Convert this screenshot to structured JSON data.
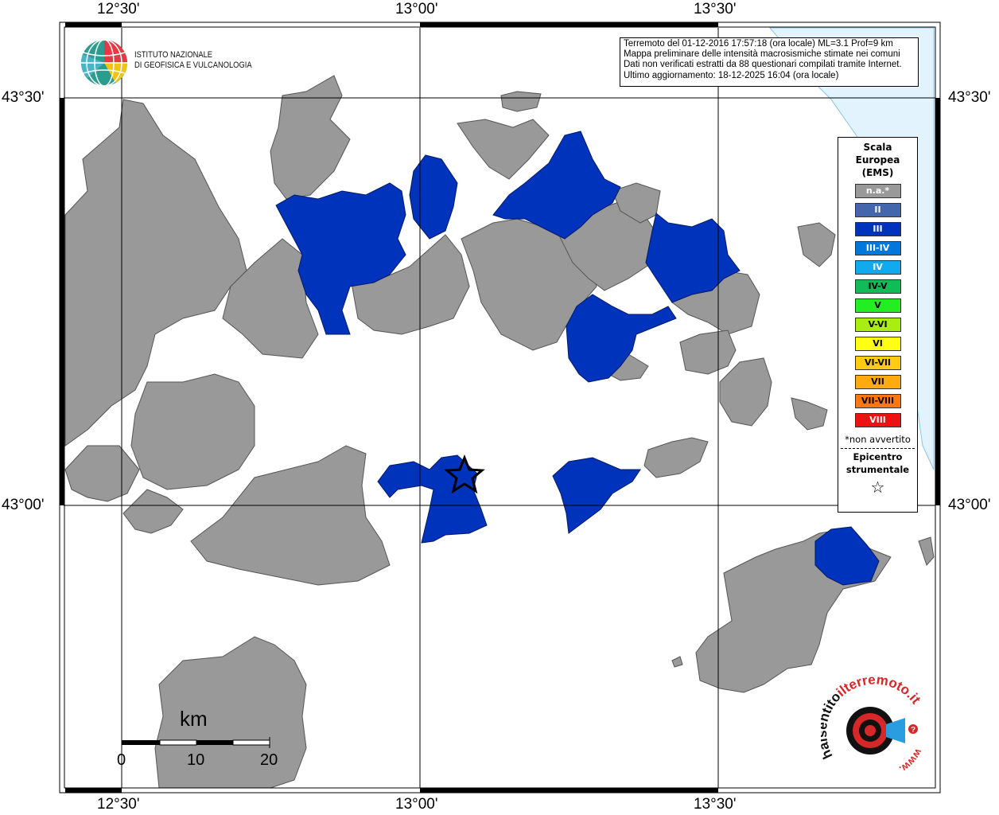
{
  "info_box": {
    "line1": "Terremoto del 01-12-2016 17:57:18 (ora locale) ML=3.1 Prof=9 km",
    "line2": "Mappa preliminare delle intensità macrosismiche stimate nei comuni",
    "line3": "Dati non verificati estratti da 88 questionari compilati tramite Internet.",
    "line4": "Ultimo aggiornamento: 18-12-2025 16:04 (ora locale)"
  },
  "axes": {
    "top": [
      "12°30'",
      "13°00'",
      "13°30'"
    ],
    "bottom": [
      "12°30'",
      "13°00'",
      "13°30'"
    ],
    "left": [
      "43°30'",
      "43°00'"
    ],
    "right": [
      "43°30'",
      "43°00'"
    ]
  },
  "logo_ingv": {
    "line1": "ISTITUTO NAZIONALE",
    "line2": "DI GEOFISICA E VULCANOLOGIA"
  },
  "legend": {
    "title1": "Scala",
    "title2": "Europea",
    "title3": "(EMS)",
    "classes": [
      {
        "label": "n.a.*",
        "color": "#999999",
        "text": "#ffffff"
      },
      {
        "label": "II",
        "color": "#4466aa",
        "text": "#ffffff"
      },
      {
        "label": "III",
        "color": "#0033bb",
        "text": "#ffffff"
      },
      {
        "label": "III-IV",
        "color": "#0077dd",
        "text": "#ffffff"
      },
      {
        "label": "IV",
        "color": "#11aaee",
        "text": "#ffffff"
      },
      {
        "label": "IV-V",
        "color": "#11bb55",
        "text": "#000000"
      },
      {
        "label": "V",
        "color": "#22ee22",
        "text": "#000000"
      },
      {
        "label": "V-VI",
        "color": "#aaee11",
        "text": "#000000"
      },
      {
        "label": "VI",
        "color": "#ffff11",
        "text": "#000000"
      },
      {
        "label": "VI-VII",
        "color": "#ffcc11",
        "text": "#000000"
      },
      {
        "label": "VII",
        "color": "#ffaa11",
        "text": "#000000"
      },
      {
        "label": "VII-VIII",
        "color": "#ff7711",
        "text": "#000000"
      },
      {
        "label": "VIII",
        "color": "#ee1111",
        "text": "#ffffff"
      }
    ],
    "non_avvertito": "*non avvertito",
    "epicentro1": "Epicentro",
    "epicentro2": "strumentale",
    "epicentro_symbol": "☆"
  },
  "scale_bar": {
    "unit": "km",
    "labels": [
      "0",
      "10",
      "20"
    ]
  },
  "logo_hst": {
    "text_black": "haisentito",
    "text_red": "ilterremoto.it",
    "text_url": "www."
  },
  "map_colors": {
    "sea": "#e3f3fd",
    "gray_municipality": "#999999",
    "blue_III": "#0033bb",
    "frame": "#000000"
  }
}
